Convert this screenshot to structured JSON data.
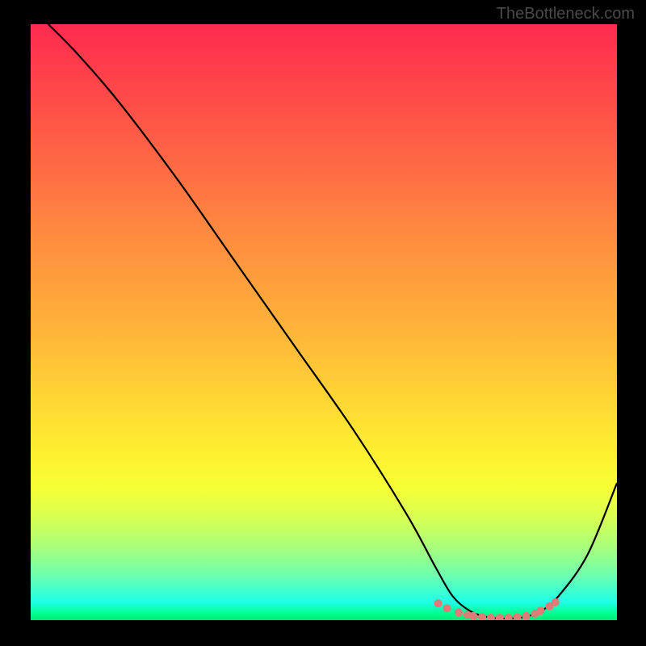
{
  "watermark": "TheBottleneck.com",
  "chart_data": {
    "type": "line",
    "title": "",
    "xlabel": "",
    "ylabel": "",
    "xlim": [
      0,
      100
    ],
    "ylim": [
      0,
      100
    ],
    "background": "vertical-gradient red-to-green",
    "series": [
      {
        "name": "bottleneck-curve",
        "x": [
          3,
          8,
          15,
          25,
          35,
          45,
          55,
          64,
          69,
          72,
          75,
          78,
          81,
          84,
          87,
          90,
          95,
          100
        ],
        "y": [
          100,
          95,
          87,
          74,
          60,
          46,
          32,
          18,
          9,
          4,
          1.5,
          0.5,
          0.3,
          0.5,
          1.5,
          4,
          11,
          23
        ]
      }
    ],
    "highlighted_points": {
      "name": "optimal-zone",
      "x": [
        69.5,
        71,
        73,
        74.5,
        75.5,
        77,
        78.5,
        80,
        81.5,
        83,
        84.5,
        86,
        87,
        88.5,
        89.5
      ],
      "y": [
        2.8,
        2.0,
        1.3,
        0.9,
        0.7,
        0.5,
        0.4,
        0.4,
        0.4,
        0.5,
        0.7,
        1.1,
        1.6,
        2.3,
        3.0
      ]
    }
  }
}
